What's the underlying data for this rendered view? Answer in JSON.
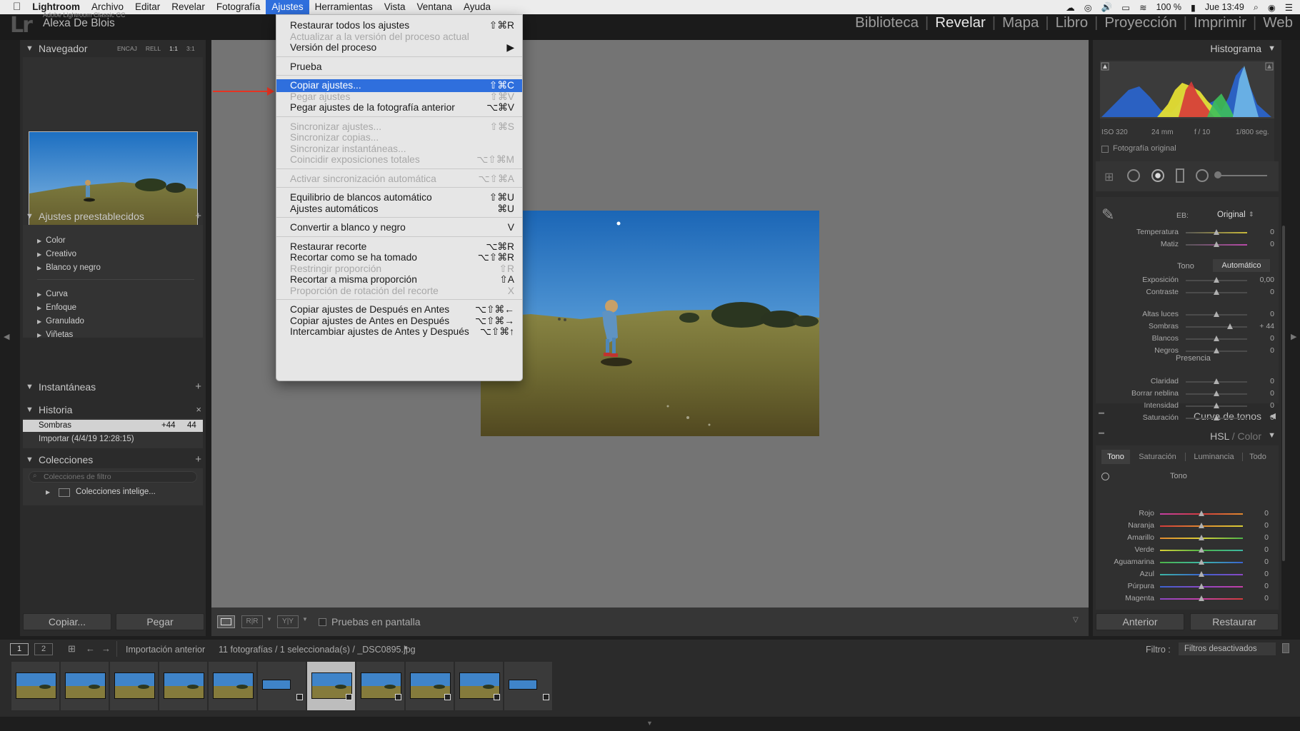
{
  "menubar": {
    "app": "Lightroom",
    "items": [
      "Archivo",
      "Editar",
      "Revelar",
      "Fotografía",
      "Ajustes",
      "Herramientas",
      "Vista",
      "Ventana",
      "Ayuda"
    ],
    "active": "Ajustes",
    "battery": "100 %",
    "clock": "Jue 13:49"
  },
  "identity": {
    "product": "Adobe Lightroom Classic CC",
    "user": "Alexa De Blois"
  },
  "modules": [
    "Biblioteca",
    "Revelar",
    "Mapa",
    "Libro",
    "Proyección",
    "Imprimir",
    "Web"
  ],
  "current_module": "Revelar",
  "navigator": {
    "title": "Navegador",
    "zoom": [
      "ENCAJ",
      "RELL",
      "1:1",
      "3:1"
    ]
  },
  "presets": {
    "title": "Ajustes preestablecidos",
    "group1": [
      "Color",
      "Creativo",
      "Blanco y negro"
    ],
    "group2": [
      "Curva",
      "Enfoque",
      "Granulado",
      "Viñetas"
    ]
  },
  "snapshots": {
    "title": "Instantáneas"
  },
  "history": {
    "title": "Historia",
    "items": [
      {
        "label": "Sombras",
        "a": "+44",
        "b": "44"
      },
      {
        "label": "Importar (4/4/19 12:28:15)",
        "a": "",
        "b": ""
      }
    ]
  },
  "collections": {
    "title": "Colecciones",
    "filter_placeholder": "Colecciones de filtro",
    "item": "Colecciones intelige..."
  },
  "left_buttons": {
    "copy": "Copiar...",
    "paste": "Pegar"
  },
  "toolbar": {
    "soft_proof": "Pruebas en pantalla",
    "rr": "R|R",
    "yy": "Y|Y"
  },
  "dropdown": [
    {
      "label": "Restaurar todos los ajustes",
      "sc": "⇧⌘R",
      "dis": false
    },
    {
      "label": "Actualizar a la versión del proceso actual",
      "sc": "",
      "dis": true
    },
    {
      "label": "Versión del proceso",
      "sc": "▶",
      "dis": false
    },
    {
      "sep": true
    },
    {
      "label": "Prueba",
      "sc": "",
      "dis": false
    },
    {
      "sep": true
    },
    {
      "label": "Copiar ajustes...",
      "sc": "⇧⌘C",
      "dis": false,
      "hl": true
    },
    {
      "label": "Pegar ajustes",
      "sc": "⇧⌘V",
      "dis": true
    },
    {
      "label": "Pegar ajustes de la fotografía anterior",
      "sc": "⌥⌘V",
      "dis": false
    },
    {
      "sep": true
    },
    {
      "label": "Sincronizar ajustes...",
      "sc": "⇧⌘S",
      "dis": true
    },
    {
      "label": "Sincronizar copias...",
      "sc": "",
      "dis": true
    },
    {
      "label": "Sincronizar instantáneas...",
      "sc": "",
      "dis": true
    },
    {
      "label": "Coincidir exposiciones totales",
      "sc": "⌥⇧⌘M",
      "dis": true
    },
    {
      "sep": true
    },
    {
      "label": "Activar sincronización automática",
      "sc": "⌥⇧⌘A",
      "dis": true
    },
    {
      "sep": true
    },
    {
      "label": "Equilibrio de blancos automático",
      "sc": "⇧⌘U",
      "dis": false
    },
    {
      "label": "Ajustes automáticos",
      "sc": "⌘U",
      "dis": false
    },
    {
      "sep": true
    },
    {
      "label": "Convertir a blanco y negro",
      "sc": "V",
      "dis": false
    },
    {
      "sep": true
    },
    {
      "label": "Restaurar recorte",
      "sc": "⌥⌘R",
      "dis": false
    },
    {
      "label": "Recortar como se ha tomado",
      "sc": "⌥⇧⌘R",
      "dis": false
    },
    {
      "label": "Restringir proporción",
      "sc": "⇧R",
      "dis": true
    },
    {
      "label": "Recortar a misma proporción",
      "sc": "⇧A",
      "dis": false
    },
    {
      "label": "Proporción de rotación del recorte",
      "sc": "X",
      "dis": true
    },
    {
      "sep": true
    },
    {
      "label": "Copiar ajustes de Después en Antes",
      "sc": "⌥⇧⌘←",
      "dis": false
    },
    {
      "label": "Copiar ajustes de Antes en Después",
      "sc": "⌥⇧⌘→",
      "dis": false
    },
    {
      "label": "Intercambiar ajustes de Antes y Después",
      "sc": "⌥⇧⌘↑",
      "dis": false
    }
  ],
  "histogram": {
    "title": "Histograma",
    "iso": "ISO 320",
    "focal": "24 mm",
    "aperture": "f / 10",
    "shutter": "1/800 seg.",
    "original_label": "Fotografía original"
  },
  "basic": {
    "wb_label": "EB:",
    "wb_value": "Original",
    "wb_sliders": [
      {
        "label": "Temperatura",
        "value": "0",
        "pos": 0.5
      },
      {
        "label": "Matiz",
        "value": "0",
        "pos": 0.5
      }
    ],
    "tone_label": "Tono",
    "auto_label": "Automático",
    "tone_sliders": [
      {
        "label": "Exposición",
        "value": "0,00",
        "pos": 0.5
      },
      {
        "label": "Contraste",
        "value": "0",
        "pos": 0.5
      }
    ],
    "tone2_sliders": [
      {
        "label": "Altas luces",
        "value": "0",
        "pos": 0.5
      },
      {
        "label": "Sombras",
        "value": "+ 44",
        "pos": 0.72
      },
      {
        "label": "Blancos",
        "value": "0",
        "pos": 0.5
      },
      {
        "label": "Negros",
        "value": "0",
        "pos": 0.5
      }
    ],
    "presence_label": "Presencia",
    "presence_sliders": [
      {
        "label": "Claridad",
        "value": "0",
        "pos": 0.5
      },
      {
        "label": "Borrar neblina",
        "value": "0",
        "pos": 0.5
      },
      {
        "label": "Intensidad",
        "value": "0",
        "pos": 0.5
      },
      {
        "label": "Saturación",
        "value": "0",
        "pos": 0.5
      }
    ]
  },
  "tone_curve": {
    "title": "Curva de tonos"
  },
  "hsl": {
    "title_a": "HSL",
    "title_sep": "/",
    "title_b": "Color",
    "tabs": [
      "Tono",
      "Saturación",
      "Luminancia",
      "Todo"
    ],
    "section": "Tono",
    "sliders": [
      {
        "label": "Rojo",
        "value": "0",
        "color": "#d23b3b"
      },
      {
        "label": "Naranja",
        "value": "0",
        "color": "#e0892e"
      },
      {
        "label": "Amarillo",
        "value": "0",
        "color": "#d9cf36"
      },
      {
        "label": "Verde",
        "value": "0",
        "color": "#4db548"
      },
      {
        "label": "Aguamarina",
        "value": "0",
        "color": "#3cb6a5"
      },
      {
        "label": "Azul",
        "value": "0",
        "color": "#3a63d1"
      },
      {
        "label": "Púrpura",
        "value": "0",
        "color": "#8d47c4"
      },
      {
        "label": "Magenta",
        "value": "0",
        "color": "#c43fa5"
      }
    ]
  },
  "right_buttons": {
    "prev": "Anterior",
    "reset": "Restaurar"
  },
  "filmbar": {
    "page1": "1",
    "page2": "2",
    "source": "Importación anterior",
    "info": "11 fotografías / 1 seleccionada(s) / _DSC0895.jpg",
    "filter_label": "Filtro :",
    "filter_value": "Filtros desactivados"
  },
  "colors": {
    "accent": "#2f6fdd",
    "arrow": "#e53322"
  }
}
